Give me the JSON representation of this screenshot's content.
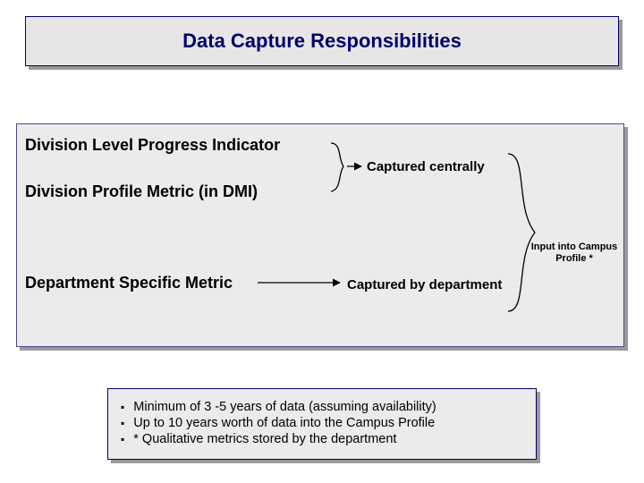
{
  "title": "Data Capture Responsibilities",
  "metrics": {
    "division_progress": "Division Level Progress Indicator",
    "division_profile": "Division Profile Metric (in DMI)",
    "department_specific": "Department Specific Metric"
  },
  "captured": {
    "centrally": "Captured centrally",
    "by_dept": "Captured by department"
  },
  "campus_note_line1": "Input into Campus",
  "campus_note_line2": "Profile *",
  "notes": {
    "n1": "Minimum of 3 -5 years of data (assuming availability)",
    "n2": "Up to 10 years worth of data into the Campus Profile",
    "n3": "* Qualitative metrics stored by the department"
  }
}
